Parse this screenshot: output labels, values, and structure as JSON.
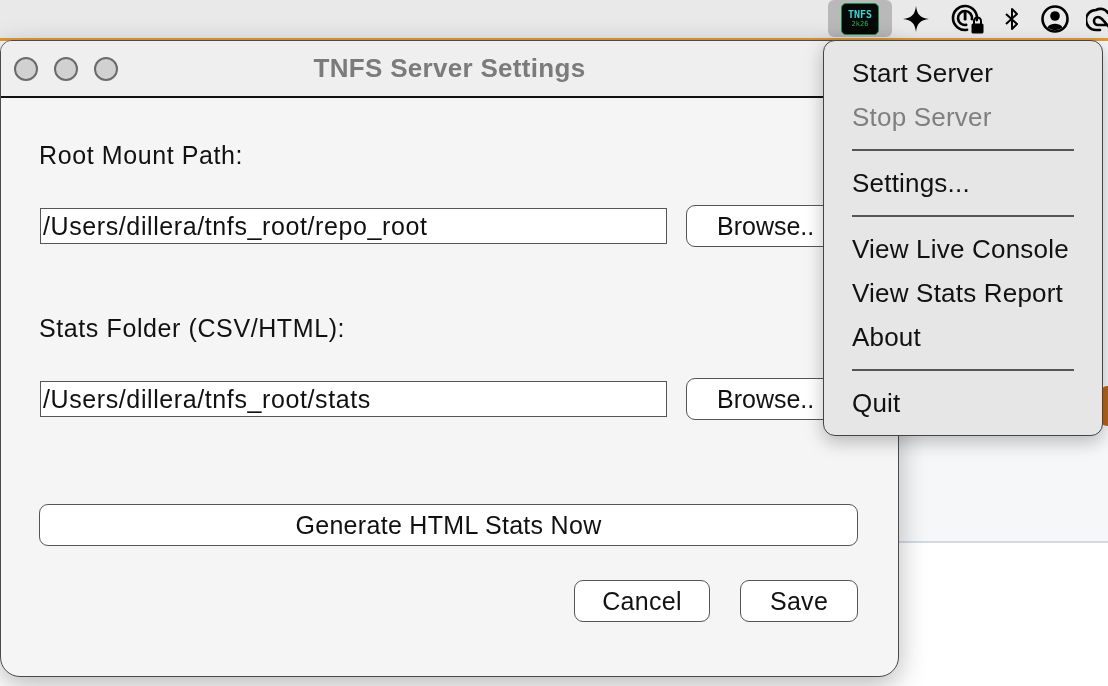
{
  "menu_bar": {
    "app_icon": {
      "title": "TNFS",
      "subtitle": "2k26",
      "selected": true
    }
  },
  "window": {
    "title": "TNFS Server Settings",
    "active": false
  },
  "settings": [
    {
      "label": "Root Mount Path:",
      "value": "/Users/dillera/tnfs_root/repo_root",
      "button": "Browse.."
    },
    {
      "label": "Stats Folder (CSV/HTML):",
      "value": "/Users/dillera/tnfs_root/stats",
      "button": "Browse.."
    }
  ],
  "generate_button": "Generate HTML Stats Now",
  "buttons": [
    "Cancel",
    "Save"
  ],
  "status_menu": {
    "items": [
      {
        "kind": "item",
        "label": "Start Server",
        "disabled": false
      },
      {
        "kind": "item",
        "label": "Stop Server",
        "disabled": true
      },
      {
        "kind": "separator"
      },
      {
        "kind": "item",
        "label": "Settings...",
        "disabled": false
      },
      {
        "kind": "separator"
      },
      {
        "kind": "item",
        "label": "View Live Console",
        "disabled": false
      },
      {
        "kind": "item",
        "label": "View Stats Report",
        "disabled": false
      },
      {
        "kind": "item",
        "label": "About",
        "disabled": false
      },
      {
        "kind": "separator"
      },
      {
        "kind": "item",
        "label": "Quit",
        "disabled": false
      }
    ]
  }
}
